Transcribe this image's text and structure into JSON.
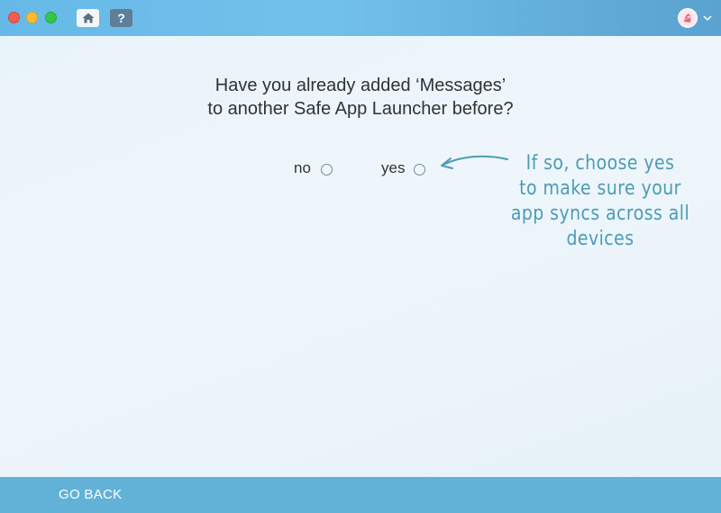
{
  "window": {
    "traffic_lights": [
      "close",
      "minimize",
      "maximize"
    ],
    "home_icon": "home-icon",
    "help_label": "?",
    "avatar_icon": "user-avatar-icon",
    "menu_icon": "chevron-down-icon"
  },
  "prompt": {
    "line1": "Have you already added ‘Messages’",
    "line2": "to another Safe App Launcher before?"
  },
  "options": {
    "no_label": "no",
    "yes_label": "yes",
    "selected": null
  },
  "hint": {
    "line1": "If so, choose yes",
    "line2": "to make sure your",
    "line3": "app syncs across all",
    "line4": "devices"
  },
  "footer": {
    "back_label": "GO BACK"
  },
  "colors": {
    "titlebar": "#66b9e6",
    "footer": "#62b2d8",
    "hint": "#4e9bb6",
    "background": "#eaf4fa"
  }
}
